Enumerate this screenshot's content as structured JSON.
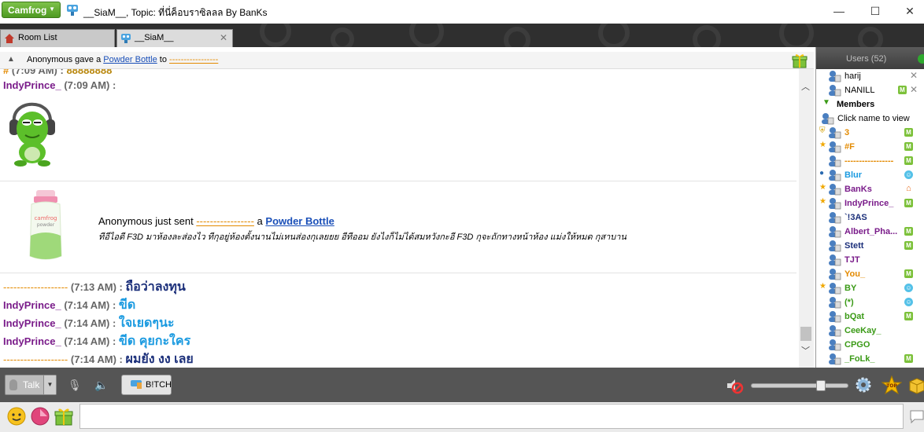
{
  "titlebar": {
    "app_button": "Camfrog",
    "window_title": "__SiaM__, Topic: ที่นี่ค็อบราซิลลล By BanKs",
    "controls": {
      "minimize": "—",
      "maximize": "☐",
      "close": "✕"
    }
  },
  "tabs": [
    {
      "label": "Room List"
    },
    {
      "label": "__SiaM__",
      "close": "✕"
    }
  ],
  "notification": {
    "actor": "Anonymous",
    "verb": "gave a",
    "item": "Powder Bottle",
    "to": "to",
    "target": "-----------------"
  },
  "chat": {
    "partial_top": {
      "nick": "#",
      "time": "(7:09 AM) :",
      "text": "88888888"
    },
    "line1": {
      "nick": "IndyPrince_",
      "time": "(7:09 AM) :"
    },
    "gift": {
      "line": "Anonymous just sent",
      "dashes": "-----------------",
      "a": "a",
      "item": "Powder Bottle",
      "note": "ทีอีไอดี F3D มาห้องละส่องไว ทีกุอยู่ห้องตั้งนานไม่เหนส่องกุเลยยย อีทีออม ยังไงก็ไม่ได้สมหวังกะอี F3D กุจะถักทางหน้าห้อง แม่งให้หมด กุสาบาน"
    },
    "messages": [
      {
        "nick": "-------------------",
        "time": "(7:13 AM) :",
        "text": "ถือว่าลงทุน",
        "style": "navy",
        "nick_style": "orange"
      },
      {
        "nick": "IndyPrince_",
        "time": "(7:14 AM) :",
        "text": "ขีด",
        "style": "blue",
        "nick_style": "purple"
      },
      {
        "nick": "IndyPrince_",
        "time": "(7:14 AM) :",
        "text": "ใจเยดๆนะ",
        "style": "blue",
        "nick_style": "purple"
      },
      {
        "nick": "IndyPrince_",
        "time": "(7:14 AM) :",
        "text": "ขีด คุยกะใคร",
        "style": "blue",
        "nick_style": "purple"
      },
      {
        "nick": "-------------------",
        "time": "(7:14 AM) :",
        "text": "ผมยัง งง เลย",
        "style": "navy",
        "nick_style": "orange"
      }
    ]
  },
  "users": {
    "header": "Users (52)",
    "top": [
      {
        "name": "harij",
        "action": "✕"
      },
      {
        "name": "NANILL",
        "action": "✕",
        "badge": "M"
      }
    ],
    "members_label": "Members",
    "hint": "Click name to view",
    "list": [
      {
        "name": "3",
        "color": "orange",
        "badge": "M",
        "pre": "shield"
      },
      {
        "name": "#F",
        "color": "orange",
        "badge": "M",
        "pre": "star"
      },
      {
        "name": "-----------------",
        "color": "orange",
        "badge": "M",
        "pre": ""
      },
      {
        "name": "Blur",
        "color": "blue",
        "badge": "smile",
        "pre": "globe"
      },
      {
        "name": "BanKs",
        "color": "purple",
        "badge": "home",
        "pre": "star"
      },
      {
        "name": "IndyPrince_",
        "color": "purple",
        "badge": "M",
        "pre": "star"
      },
      {
        "name": "`!3AS",
        "color": "navy",
        "badge": "",
        "pre": ""
      },
      {
        "name": "Albert_Pha...",
        "color": "purple",
        "badge": "M",
        "pre": ""
      },
      {
        "name": "Stett",
        "color": "navy",
        "badge": "M",
        "pre": ""
      },
      {
        "name": "TJT",
        "color": "purple",
        "badge": "",
        "pre": ""
      },
      {
        "name": "You_",
        "color": "orange",
        "badge": "M",
        "pre": ""
      },
      {
        "name": "BY",
        "color": "green",
        "badge": "smile",
        "pre": "star"
      },
      {
        "name": "(*)",
        "color": "green",
        "badge": "smile",
        "pre": ""
      },
      {
        "name": "bQat",
        "color": "green",
        "badge": "M",
        "pre": ""
      },
      {
        "name": "CeeKay_",
        "color": "green",
        "badge": "",
        "pre": ""
      },
      {
        "name": "CPGO",
        "color": "green",
        "badge": "",
        "pre": ""
      },
      {
        "name": "_FoLk_",
        "color": "green",
        "badge": "M",
        "pre": ""
      }
    ]
  },
  "toolbar": {
    "talk": "Talk",
    "chip": "B!TCH",
    "volume_level": 0.72
  },
  "input": {
    "value": "",
    "placeholder": ""
  },
  "colors": {
    "green_button": "#5eab2f",
    "nick_purple": "#7a1c8a",
    "nick_orange": "#e38a00",
    "msg_blue": "#1a9ae0",
    "msg_navy": "#1b2f7a",
    "member_green": "#3a9a16"
  }
}
